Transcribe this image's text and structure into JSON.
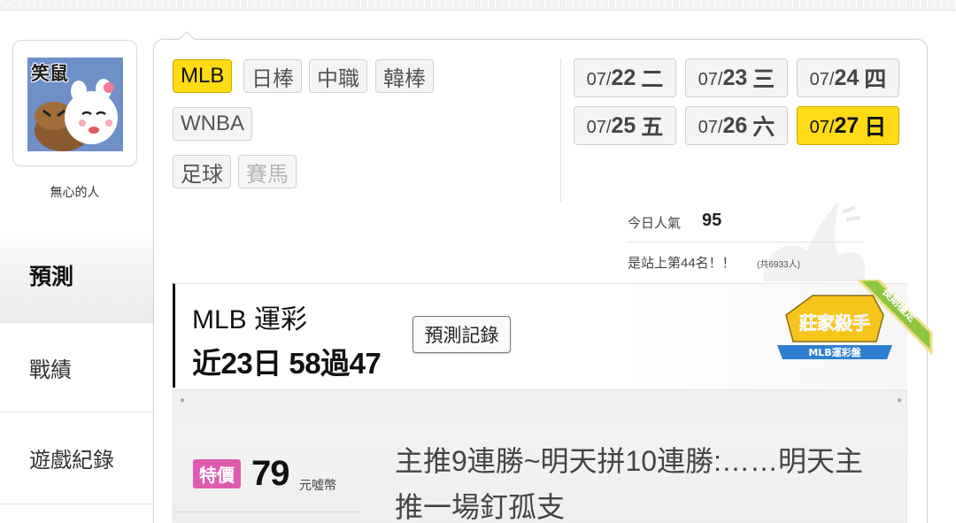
{
  "user": {
    "avatar_text": "笑鼠",
    "name": "無心的人"
  },
  "sidebar": {
    "items": [
      {
        "label": "預測",
        "active": true
      },
      {
        "label": "戰績"
      },
      {
        "label": "遊戲紀錄"
      }
    ]
  },
  "sports": {
    "items": [
      {
        "label": "MLB",
        "active": true
      },
      {
        "label": "日棒"
      },
      {
        "label": "中職"
      },
      {
        "label": "韓棒"
      },
      {
        "label": "WNBA"
      },
      {
        "label": "足球"
      },
      {
        "label": "賽馬",
        "disabled": true
      }
    ]
  },
  "dates": {
    "items": [
      {
        "prefix": "07/",
        "day": "22",
        "dow": "二"
      },
      {
        "prefix": "07/",
        "day": "23",
        "dow": "三"
      },
      {
        "prefix": "07/",
        "day": "24",
        "dow": "四"
      },
      {
        "prefix": "07/",
        "day": "25",
        "dow": "五"
      },
      {
        "prefix": "07/",
        "day": "26",
        "dow": "六"
      },
      {
        "prefix": "07/",
        "day": "27",
        "dow": "日",
        "active": true
      }
    ]
  },
  "popularity": {
    "label": "今日人氣",
    "value": "95",
    "rank_text": "是站上第44名！！",
    "rank_total": "(共6933人)"
  },
  "mlb_card": {
    "title": "MLB 運彩",
    "record": "近23日 58過47",
    "record_button": "預測記錄",
    "badge_title": "莊家殺手",
    "badge_sub": "MLB運彩盤",
    "ribbon": "長期穩定"
  },
  "prediction": {
    "sale_label": "特價",
    "price": "79",
    "unit": "元噓幣",
    "title": "主推9連勝~明天拼10連勝:……明天主推一場釘孤支"
  },
  "colors": {
    "accent_yellow": "#ffdb16",
    "sale_pink": "#e05bb0",
    "avatar_blue": "#6f8fc9"
  }
}
